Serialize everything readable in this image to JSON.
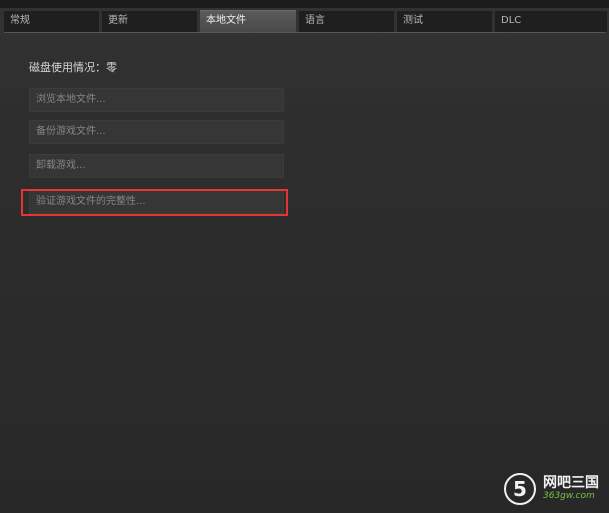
{
  "tabs": [
    {
      "label": "常规"
    },
    {
      "label": "更新"
    },
    {
      "label": "本地文件"
    },
    {
      "label": "语言"
    },
    {
      "label": "测试"
    },
    {
      "label": "DLC"
    }
  ],
  "local_files": {
    "disk_usage": "磁盘使用情况：零",
    "buttons": {
      "browse": "浏览本地文件...",
      "backup": "备份游戏文件...",
      "uninstall": "卸载游戏...",
      "verify": "验证游戏文件的完整性..."
    }
  },
  "watermark": {
    "logo_glyph": "5",
    "title": "网吧三国",
    "url": "363gw.com"
  },
  "colors": {
    "highlight_border": "#e53535",
    "watermark_url": "#7bc142"
  }
}
